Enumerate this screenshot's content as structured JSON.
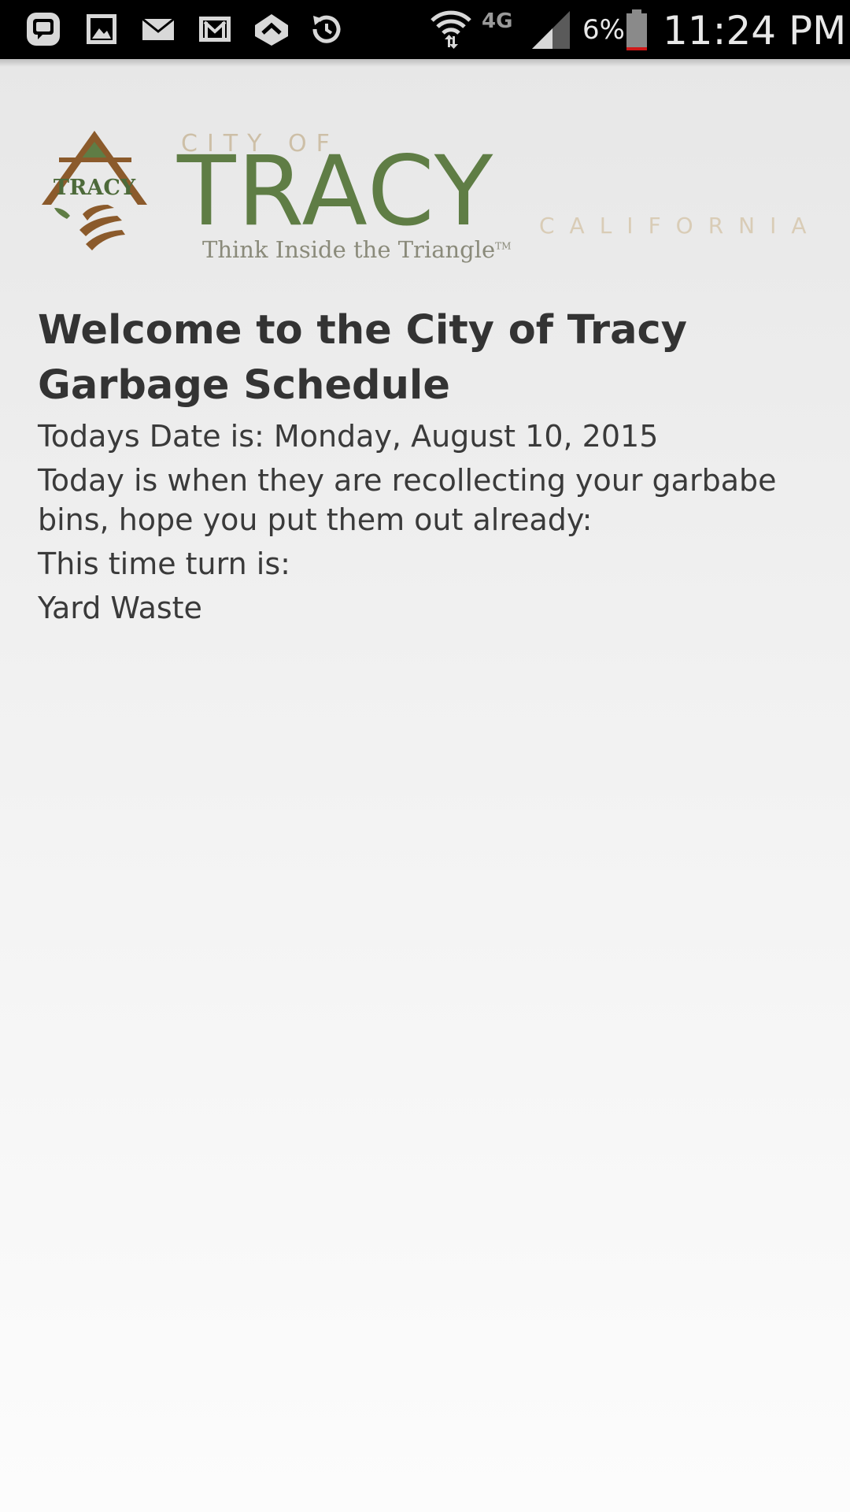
{
  "status_bar": {
    "icons": [
      "messenger-icon",
      "gallery-icon",
      "email-icon",
      "gmail-icon",
      "app-notification-icon",
      "sync-icon",
      "wifi-icon",
      "4g-lte-icon",
      "signal-icon",
      "battery-icon"
    ],
    "network": "4G",
    "battery_percent": "6%",
    "battery_level": 0.06,
    "time": "11:24 PM"
  },
  "logo": {
    "emblem_text": "TRACY",
    "city_of": "CITY OF",
    "name": "TRACY",
    "tagline": "Think Inside the Triangle",
    "trademark": "TM",
    "state": "CALIFORNIA"
  },
  "main": {
    "heading": "Welcome to the City of Tracy Garbage Schedule",
    "date_line": "Todays Date is: Monday, August 10, 2015",
    "message": "Today is when they are recollecting your garbabe bins, hope you put them out already:",
    "turn_label": "This time turn is:",
    "turn_value": "Yard Waste"
  },
  "colors": {
    "logo_green": "#5f7d45",
    "logo_brown": "#8b5a2b",
    "logo_tan": "#cdbfa7",
    "status_bar": "#000000"
  }
}
